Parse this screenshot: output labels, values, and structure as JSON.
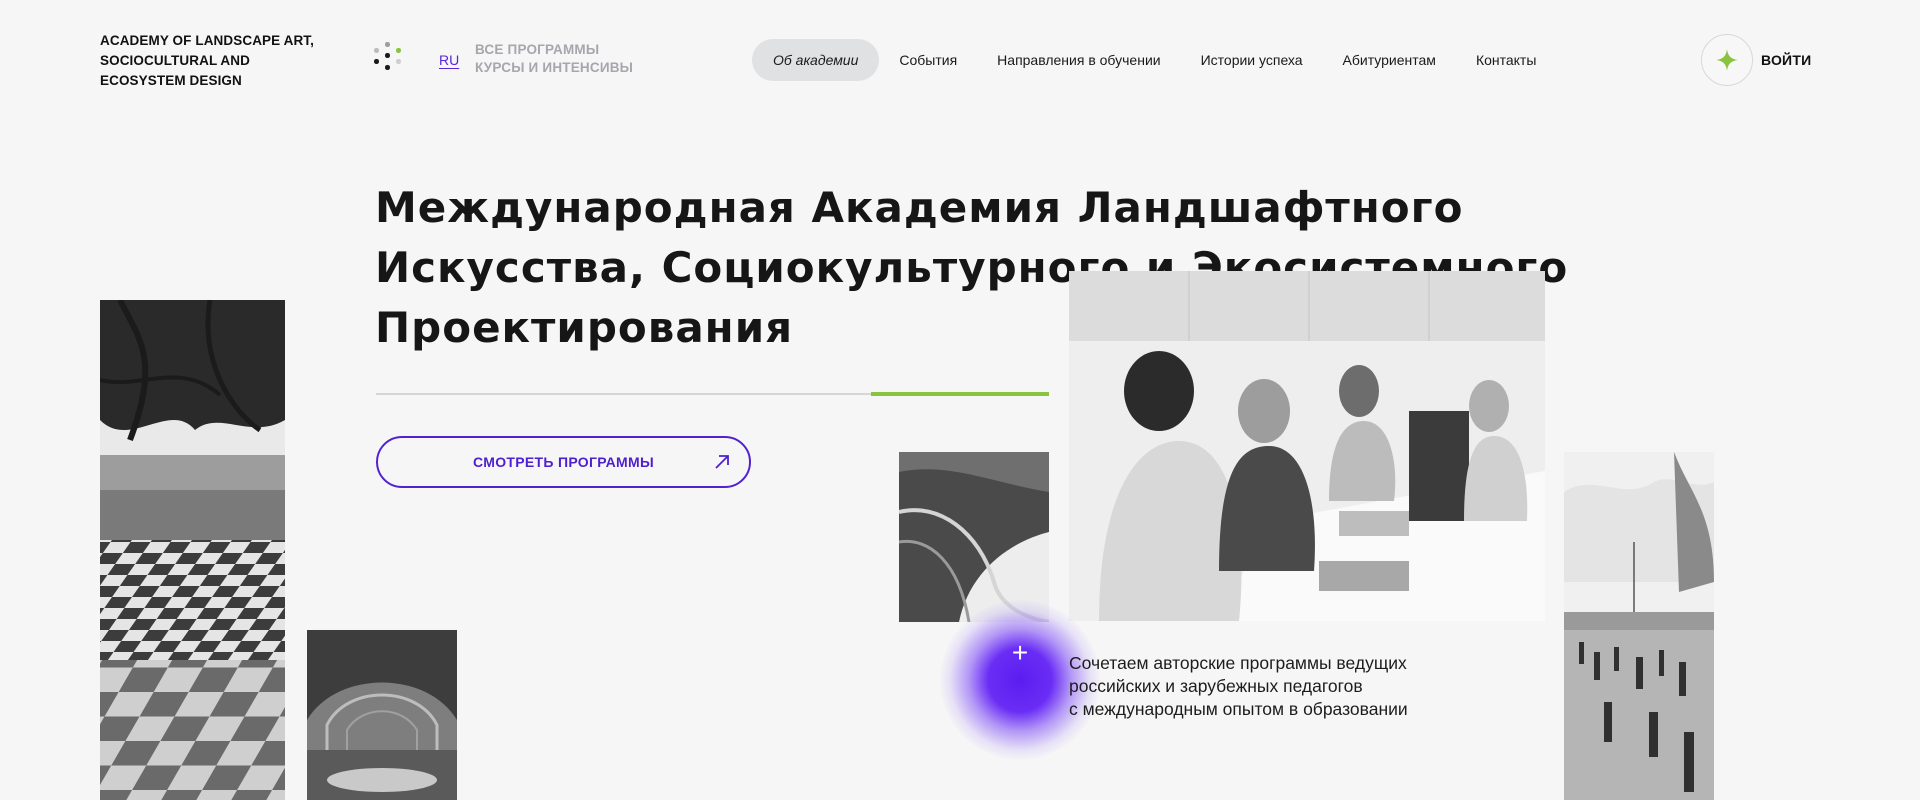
{
  "brand": {
    "lines": [
      "ACADEMY OF LANDSCAPE ART,",
      "SOCIOCULTURAL AND",
      "ECOSYSTEM DESIGN"
    ]
  },
  "header": {
    "lang": "RU",
    "programs_lines": [
      "ВСЕ ПРОГРАММЫ",
      "КУРСЫ И ИНТЕНСИВЫ"
    ],
    "nav": [
      {
        "label": "Об академии",
        "active": true
      },
      {
        "label": "События",
        "active": false
      },
      {
        "label": "Направления в обучении",
        "active": false
      },
      {
        "label": "Истории успеха",
        "active": false
      },
      {
        "label": "Абитуриентам",
        "active": false
      },
      {
        "label": "Контакты",
        "active": false
      }
    ],
    "login_label": "ВОЙТИ"
  },
  "hero": {
    "headline_lines": [
      "Международная Академия Ландшафтного",
      "Искусства, Социокультурного и Экосистемного",
      "Проектирования"
    ],
    "cta_label": "СМОТРЕТЬ ПРОГРАММЫ",
    "plus_label": "+",
    "description_lines": [
      "Сочетаем авторские программы ведущих",
      "российских и зарубежных педагогов",
      "с международным опытом в образовании"
    ]
  },
  "colors": {
    "accent": "#5222d0",
    "green": "#8ac43f",
    "background": "#f6f6f6",
    "nav_active_bg": "#e0e1e3"
  },
  "icons": {
    "logo": "dots-grid-icon",
    "login": "sparkle-star-icon",
    "cta": "arrow-up-right-icon"
  }
}
